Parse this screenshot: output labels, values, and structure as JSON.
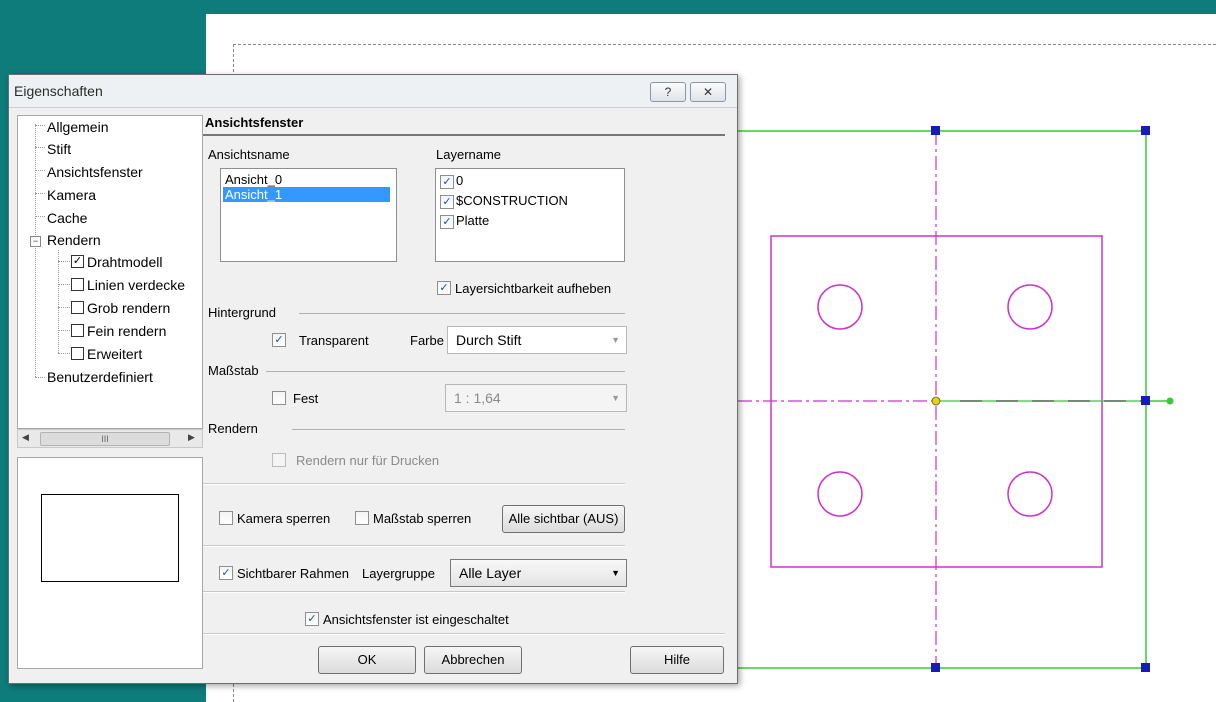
{
  "dialog": {
    "title": "Eigenschaften",
    "help_glyph": "?",
    "close_glyph": "✕"
  },
  "tree": {
    "items": [
      "Allgemein",
      "Stift",
      "Ansichtsfenster",
      "Kamera",
      "Cache",
      "Rendern"
    ],
    "children": [
      "Drahtmodell",
      "Linien verdecke",
      "Grob rendern",
      "Fein rendern",
      "Erweitert"
    ],
    "last": "Benutzerdefiniert",
    "expander": "−",
    "checked_child": "Drahtmodell",
    "scroll_thumb": "III"
  },
  "panel": {
    "title": "Ansichtsfenster",
    "ansichtsname_label": "Ansichtsname",
    "ansichten": [
      "Ansicht_0",
      "Ansicht_1"
    ],
    "selected_ansicht": "Ansicht_1",
    "layername_label": "Layername",
    "layers": [
      "0",
      "$CONSTRUCTION",
      "Platte"
    ],
    "layer_visibility_label": "Layersichtbarkeit aufheben",
    "hintergrund_label": "Hintergrund",
    "transparent_label": "Transparent",
    "farbe_label": "Farbe",
    "farbe_value": "Durch Stift",
    "massstab_label": "Maßstab",
    "fest_label": "Fest",
    "massstab_value": "1 : 1,64",
    "rendern_label": "Rendern",
    "rendern_druck_label": "Rendern nur für Drucken",
    "kamera_sperren_label": "Kamera sperren",
    "massstab_sperren_label": "Maßstab sperren",
    "alle_sichtbar_label": "Alle sichtbar (AUS)",
    "sichtbarer_rahmen_label": "Sichtbarer Rahmen",
    "layergruppe_label": "Layergruppe",
    "layergruppe_value": "Alle Layer",
    "eingeschaltet_label": "Ansichtsfenster ist eingeschaltet",
    "ok_label": "OK",
    "abbrechen_label": "Abbrechen",
    "hilfe_label": "Hilfe"
  },
  "glyphs": {
    "check": "✓",
    "dropdown": "▼"
  },
  "colors": {
    "accent_teal": "#0e7c7b",
    "selection_blue": "#3399ff",
    "frame_green": "#33cc33",
    "plate_magenta": "#cc33cc",
    "handle_blue": "#1a1ab8"
  }
}
